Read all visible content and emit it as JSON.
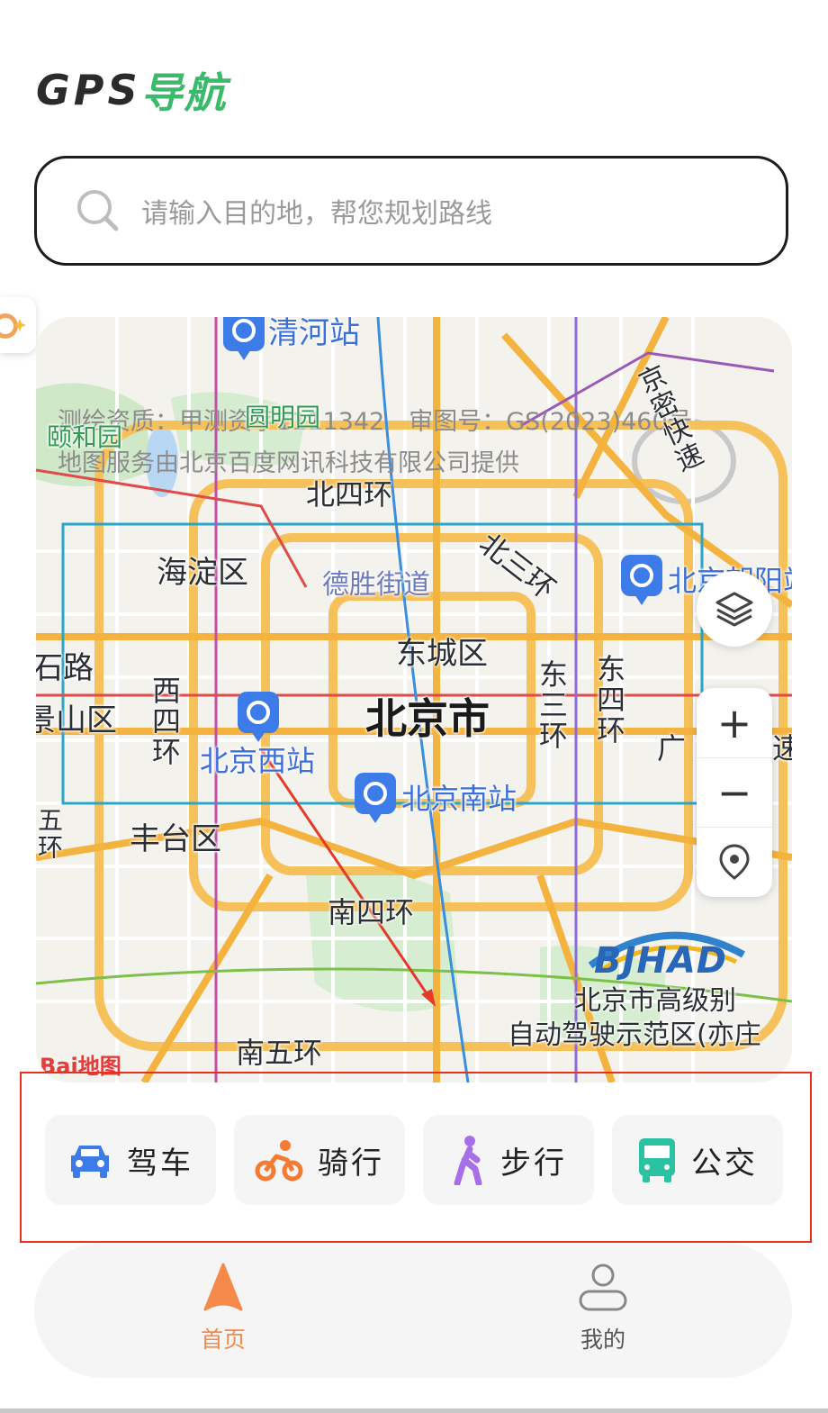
{
  "app": {
    "logo_latin": "GPS",
    "logo_cn": "导航"
  },
  "search": {
    "placeholder": "请输入目的地，帮您规划路线",
    "icon": "search-icon"
  },
  "map": {
    "credits": [
      "测绘资质：甲测资字1111342　审图号：GS(2023)460号",
      "地图服务由北京百度网讯科技有限公司提供"
    ],
    "labels": {
      "qinghe_station": "清河站",
      "yiheyuan": "颐和园",
      "yuanmingyuan": "圆明园",
      "jingmi_expressway": "京密快速",
      "north_4th_ring": "北四环",
      "north_3rd_ring": "北三环",
      "haidian": "海淀区",
      "deshengjie": "德胜街道",
      "beijing_chaoyang": "北京朝阳站",
      "dongcheng": "东城区",
      "shi_road": "石路",
      "shijingshan": "景山区",
      "west_4th_ring": "西四环",
      "beijing_city": "北京市",
      "east_3rd_ring": "东三环",
      "east_4th_ring": "东四环",
      "guang": "广",
      "su": "速",
      "beijing_west_station": "北京西站",
      "beijing_south_station": "北京南站",
      "fengtai": "丰台区",
      "wu_ring": "五环",
      "south_4th_ring": "南四环",
      "south_5th_ring": "南五环",
      "bjhad_logo": "BJHAD",
      "bjhad_line1": "北京市高级别",
      "bjhad_line2": "自动驾驶示范区(亦庄",
      "baidu_logo": "Bai地图"
    },
    "controls": {
      "layers_icon": "layers-icon",
      "zoom_in": "+",
      "zoom_out": "−",
      "locate_icon": "location-pin-icon"
    }
  },
  "modes": [
    {
      "label": "驾车",
      "icon": "car-icon",
      "color": "#3d7be8"
    },
    {
      "label": "骑行",
      "icon": "bicycle-icon",
      "color": "#f57b33"
    },
    {
      "label": "步行",
      "icon": "walk-icon",
      "color": "#a86ee8"
    },
    {
      "label": "公交",
      "icon": "bus-icon",
      "color": "#2bc1a3"
    }
  ],
  "tabs": [
    {
      "label": "首页",
      "icon": "navigation-arrow-icon",
      "active": true,
      "color": "#f5894a"
    },
    {
      "label": "我的",
      "icon": "user-icon",
      "active": false,
      "color": "#555555"
    }
  ]
}
